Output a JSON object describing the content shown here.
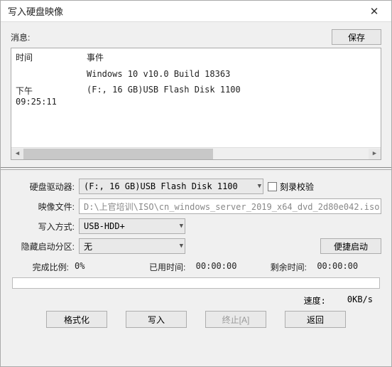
{
  "window": {
    "title": "写入硬盘映像",
    "close_symbol": "✕"
  },
  "msg": {
    "label": "消息:",
    "save_btn": "保存"
  },
  "log": {
    "col_time": "时间",
    "col_event": "事件",
    "rows": [
      {
        "time": "",
        "event": "Windows 10 v10.0 Build 18363"
      },
      {
        "time": "下午 09:25:11",
        "event": "(F:, 16 GB)USB    Flash Disk    1100"
      }
    ]
  },
  "form": {
    "drive_label": "硬盘驱动器:",
    "drive_value": "(F:, 16 GB)USB    Flash Disk    1100",
    "verify_label": "刻录校验",
    "image_label": "映像文件:",
    "image_value": "D:\\上官培训\\ISO\\cn_windows_server_2019_x64_dvd_2d80e042.iso",
    "write_mode_label": "写入方式:",
    "write_mode_value": "USB-HDD+",
    "hide_label": "隐藏启动分区:",
    "hide_value": "无",
    "quick_btn": "便捷启动"
  },
  "status": {
    "progress_label": "完成比例:",
    "progress_value": "0%",
    "elapsed_label": "已用时间:",
    "elapsed_value": "00:00:00",
    "remain_label": "剩余时间:",
    "remain_value": "00:00:00",
    "speed_label": "速度:",
    "speed_value": "0KB/s"
  },
  "buttons": {
    "format": "格式化",
    "write": "写入",
    "abort": "终止[A]",
    "back": "返回"
  }
}
